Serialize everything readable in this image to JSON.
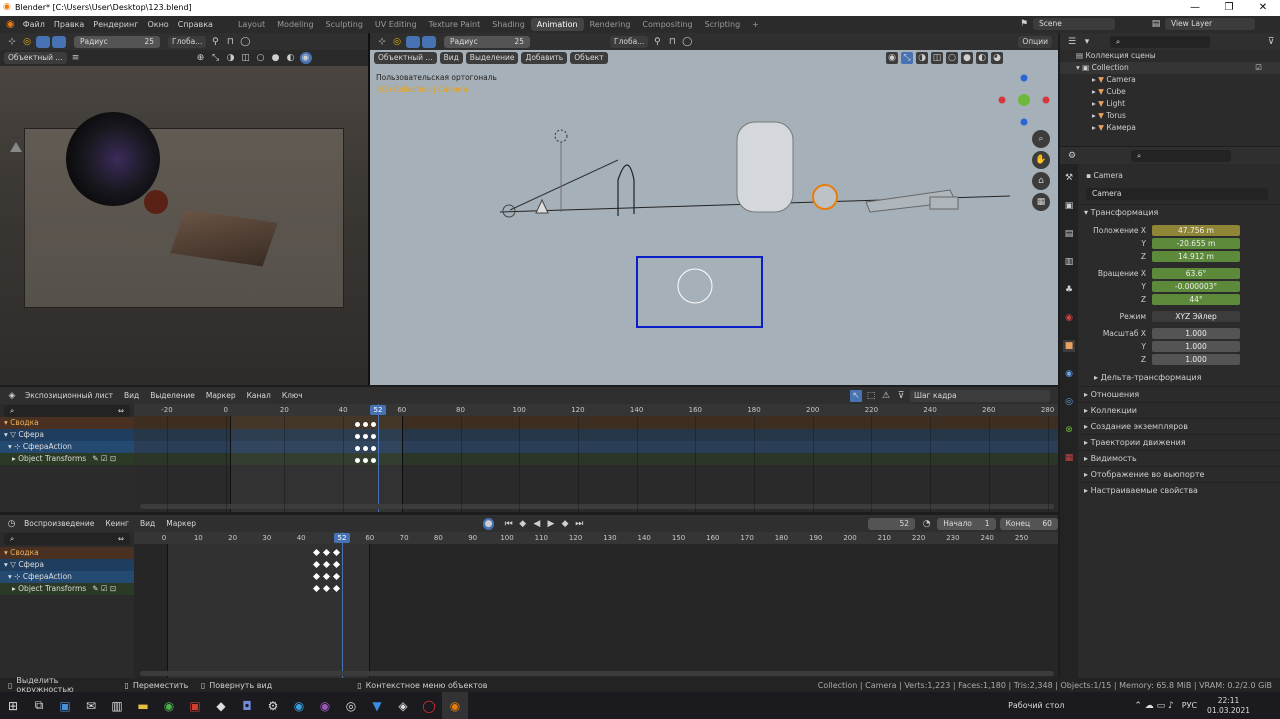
{
  "titlebar": {
    "title": "Blender* [C:\\Users\\User\\Desktop\\123.blend]"
  },
  "menu": [
    "Файл",
    "Правка",
    "Рендеринг",
    "Окно",
    "Справка"
  ],
  "workspaces": [
    "Layout",
    "Modeling",
    "Sculpting",
    "UV Editing",
    "Texture Paint",
    "Shading",
    "Animation",
    "Rendering",
    "Compositing",
    "Scripting"
  ],
  "active_workspace": "Animation",
  "scene": {
    "label": "Scene",
    "viewlayer": "View Layer"
  },
  "toolhdr": {
    "radius_label": "Радиус",
    "radius_value": "25",
    "global": "Глоба...",
    "mode": "Объектный ...",
    "options": "Опции"
  },
  "vp_right_hdr": {
    "mode": "Объектный ...",
    "view": "Вид",
    "select": "Выделение",
    "add": "Добавить",
    "object": "Объект"
  },
  "vp_right_info": {
    "line1": "Пользовательская ортогональ",
    "line2": "(52) Collection | Camera"
  },
  "dope1": {
    "mode": "Экспозиционный лист",
    "menus": [
      "Вид",
      "Выделение",
      "Маркер",
      "Канал",
      "Ключ"
    ],
    "snap": "Шаг кадра",
    "ticks": [
      "-20",
      "0",
      "20",
      "40",
      "60",
      "80",
      "100",
      "120",
      "140",
      "160",
      "180",
      "200",
      "220",
      "240",
      "260",
      "280"
    ],
    "current": "52",
    "channels": [
      "Сводка",
      "Сфера",
      "СфераAction",
      "Object Transforms"
    ]
  },
  "timeline": {
    "mode": "Воспроизведение",
    "keying": "Кеинг",
    "menus": [
      "Вид",
      "Маркер"
    ],
    "frame": "52",
    "start_label": "Начало",
    "start": "1",
    "end_label": "Конец",
    "end": "60",
    "ticks": [
      "0",
      "10",
      "20",
      "30",
      "40",
      "60",
      "70",
      "80",
      "90",
      "100",
      "110",
      "120",
      "130",
      "140",
      "150",
      "160",
      "170",
      "180",
      "190",
      "200",
      "210",
      "220",
      "230",
      "240",
      "250"
    ],
    "current": "52",
    "channels": [
      "Сводка",
      "Сфера",
      "СфераAction",
      "Object Transforms"
    ]
  },
  "outliner": {
    "title": "Коллекция сцены",
    "collection": "Collection",
    "items": [
      "Camera",
      "Cube",
      "Light",
      "Torus",
      "Камера"
    ]
  },
  "properties": {
    "object": "Camera",
    "object_field": "Camera",
    "transform": "Трансформация",
    "loc_label": "Положение X",
    "loc": [
      "47.756 m",
      "-20.655 m",
      "14.912 m"
    ],
    "rot_label": "Вращение X",
    "rot": [
      "63.6°",
      "-0.000003°",
      "44°"
    ],
    "mode_label": "Режим",
    "mode": "XYZ Эйлер",
    "scale_label": "Масштаб X",
    "scale": [
      "1.000",
      "1.000",
      "1.000"
    ],
    "axis_y": "Y",
    "axis_z": "Z",
    "delta": "Дельта-трансформация",
    "sections": [
      "Отношения",
      "Коллекции",
      "Создание экземпляров",
      "Траектории движения",
      "Видимость",
      "Отображение во вьюпорте",
      "Настраиваемые свойства"
    ]
  },
  "status": {
    "left": [
      "Выделить окружностью",
      "Переместить",
      "Повернуть вид",
      "Контекстное меню объектов"
    ],
    "right": "Collection | Camera | Verts:1,223 | Faces:1,180 | Tris:2,348 | Objects:1/15 | Memory: 65.8 MiB | VRAM: 0.2/2.0 GiB"
  },
  "taskbar": {
    "desktop": "Рабочий стол",
    "lang": "РУС",
    "time": "22:11",
    "date": "01.03.2021"
  }
}
